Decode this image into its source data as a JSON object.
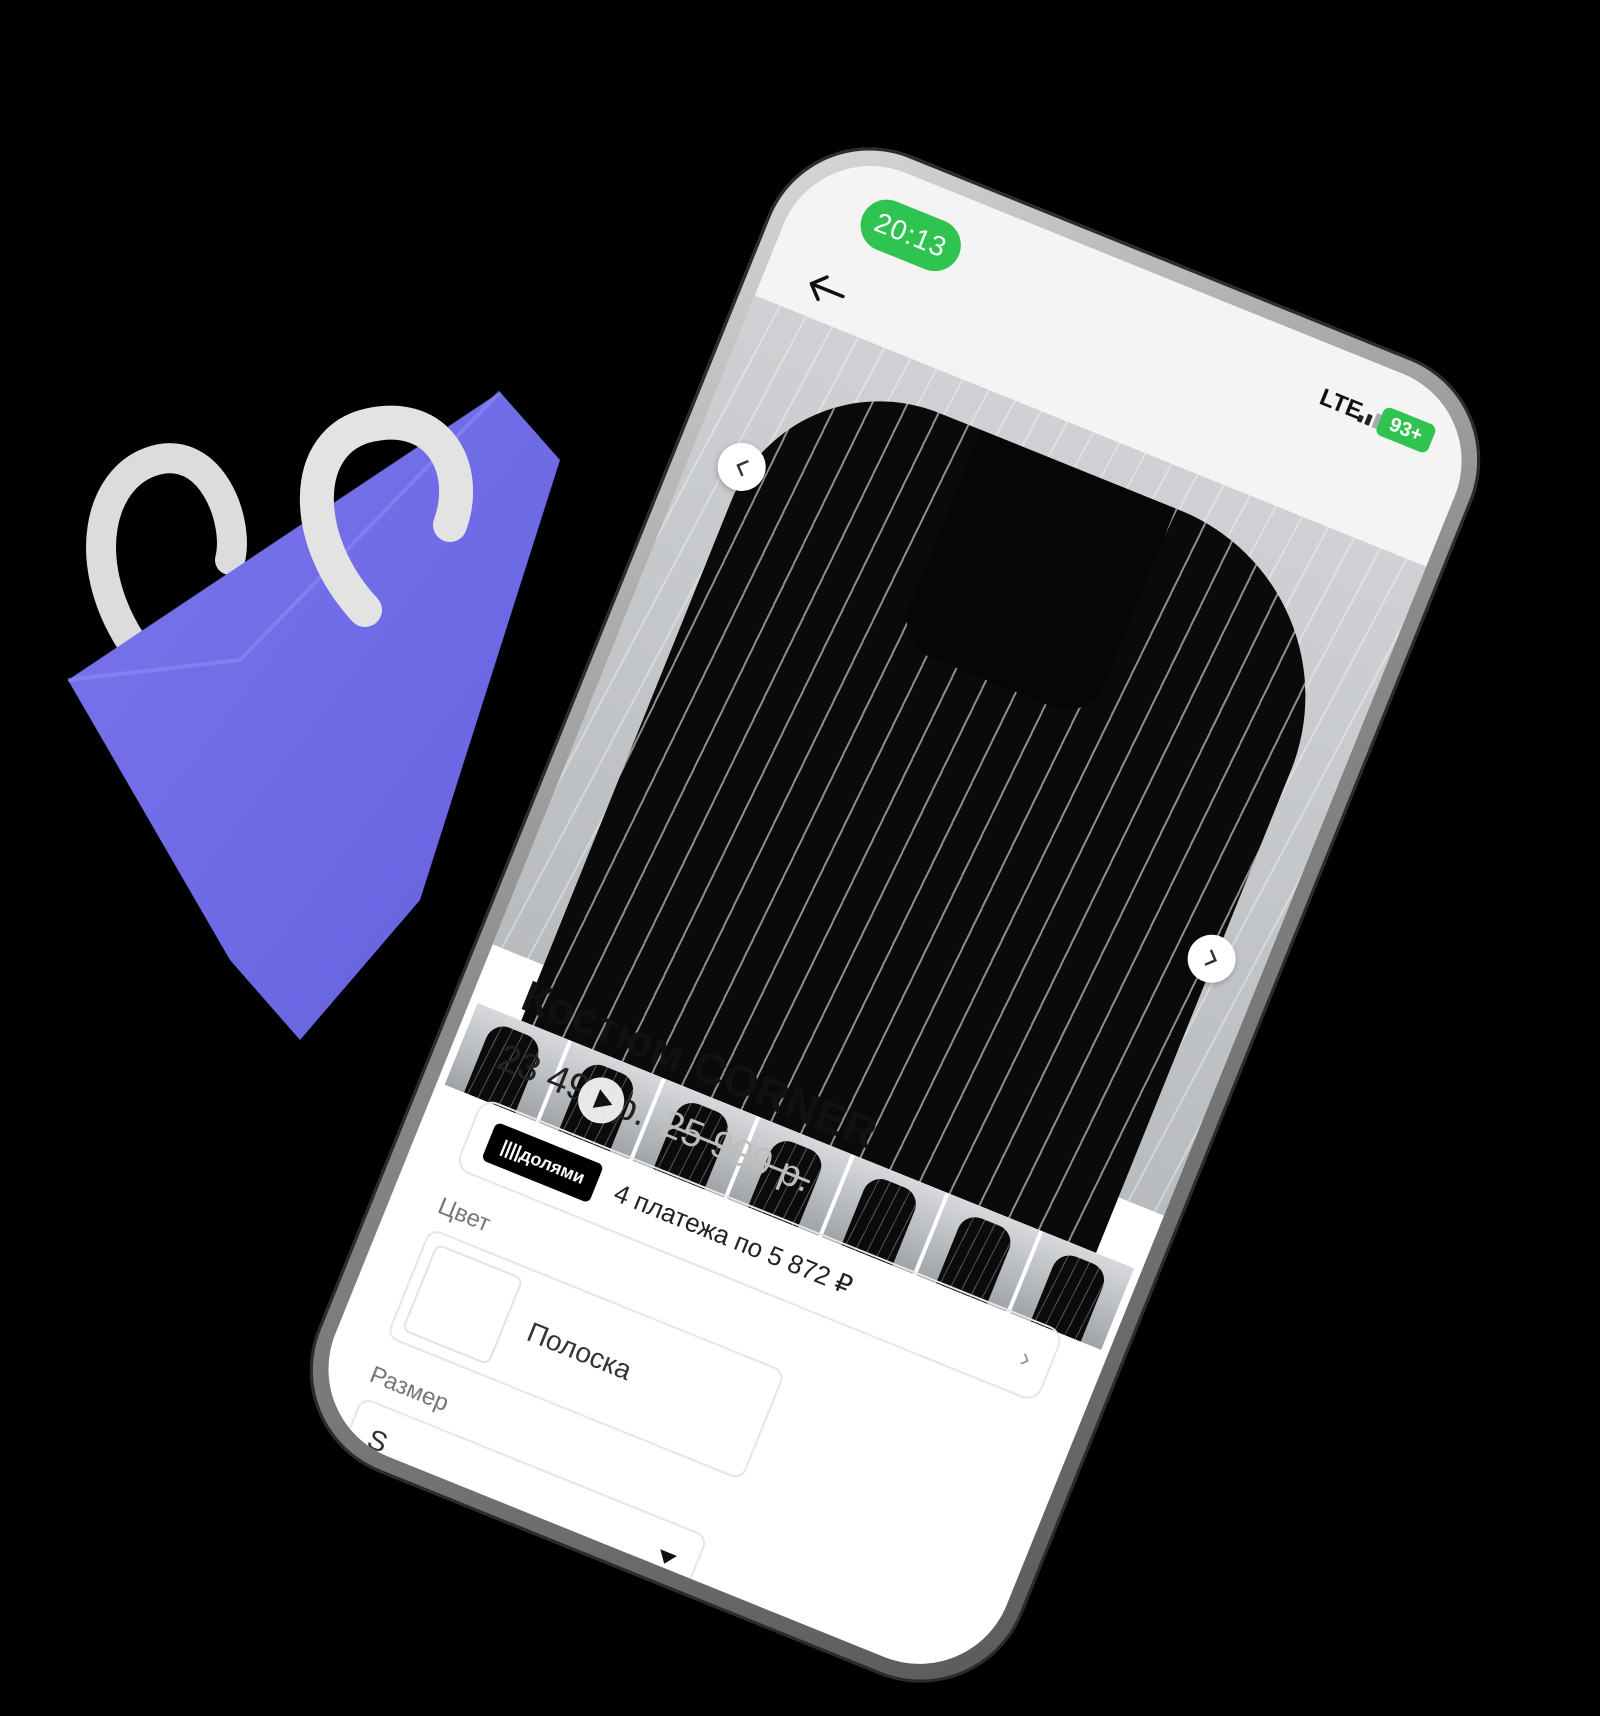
{
  "status_bar": {
    "time": "20:13",
    "network": "LTE",
    "battery": "93+"
  },
  "product": {
    "title": "Костюм CORNER",
    "price": "23 490 р.",
    "old_price": "25 900 р.",
    "split_badge": "||||долями",
    "split_text": "4 платежа по 5 872 ₽",
    "color_label": "Цвет",
    "color_value": "Полоска",
    "size_label": "Размер",
    "size_value": "S"
  },
  "colors": {
    "accent_green": "#2fc34f",
    "bag_purple": "#6f6be8"
  }
}
